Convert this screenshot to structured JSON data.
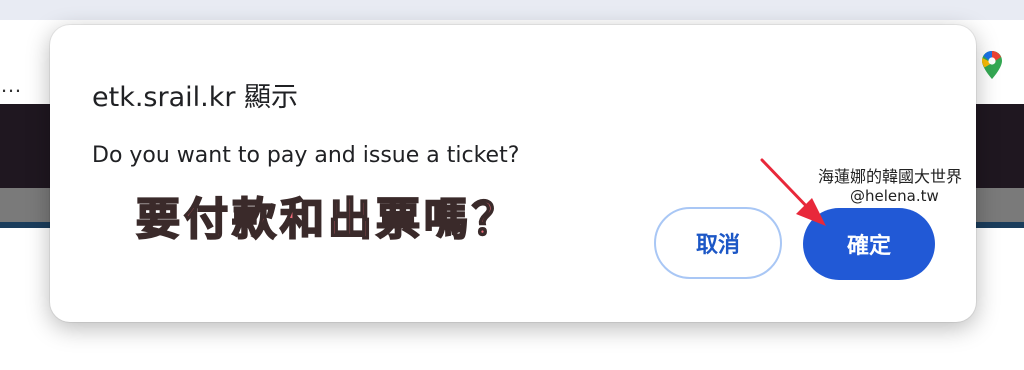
{
  "browser": {
    "bookmark_truncated": "…"
  },
  "dialog": {
    "title": "etk.srail.kr 顯示",
    "message": "Do you want to pay and issue a ticket?",
    "cancel_label": "取消",
    "ok_label": "確定"
  },
  "annotation": {
    "text": "要付款和出票嗎？",
    "color": "#f26b7a",
    "arrow_color": "#e8283a"
  },
  "watermark": {
    "title": "海蓮娜的韓國大世界",
    "handle": "@helena.tw"
  },
  "icons": {
    "maps": "google-maps-icon"
  },
  "colors": {
    "primary": "#2159d6",
    "cancel_border": "#a9c7f5",
    "site_header": "#1f1720"
  }
}
